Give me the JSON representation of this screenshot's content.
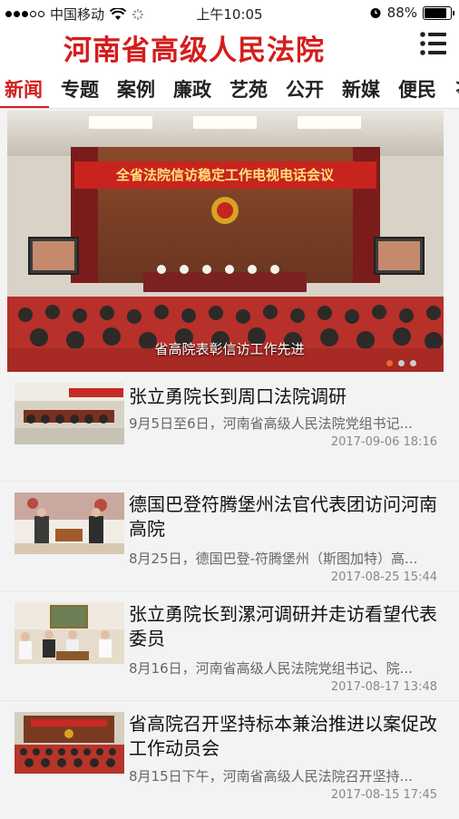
{
  "status_bar": {
    "carrier": "中国移动",
    "time": "上午10:05",
    "battery": "88%"
  },
  "header": {
    "site_title": "河南省高级人民法院"
  },
  "nav": {
    "tabs": [
      "新闻",
      "专题",
      "案例",
      "廉政",
      "艺苑",
      "公开",
      "新媒",
      "便民",
      "≯"
    ],
    "active": "新闻"
  },
  "carousel": {
    "banner_text": "全省法院信访稳定工作电视电话会议",
    "caption": "省高院表彰信访工作先进",
    "slide_count": 3,
    "active_index": 0
  },
  "news": [
    {
      "title": "张立勇院长到周口法院调研",
      "summary": "9月5日至6日，河南省高级人民法院党组书记...",
      "date": "2017-09-06 18:16"
    },
    {
      "title": "德国巴登符腾堡州法官代表团访问河南高院",
      "summary": "8月25日，德国巴登-符腾堡州（斯图加特）高...",
      "date": "2017-08-25 15:44"
    },
    {
      "title": "张立勇院长到漯河调研并走访看望代表委员",
      "summary": "8月16日，河南省高级人民法院党组书记、院...",
      "date": "2017-08-17 13:48"
    },
    {
      "title": "省高院召开坚持标本兼治推进以案促改工作动员会",
      "summary": "8月15日下午，河南省高级人民法院召开坚持...",
      "date": "2017-08-15 17:45"
    }
  ],
  "colors": {
    "accent": "#d41d1d",
    "indicator_active": "#e56a2c"
  }
}
